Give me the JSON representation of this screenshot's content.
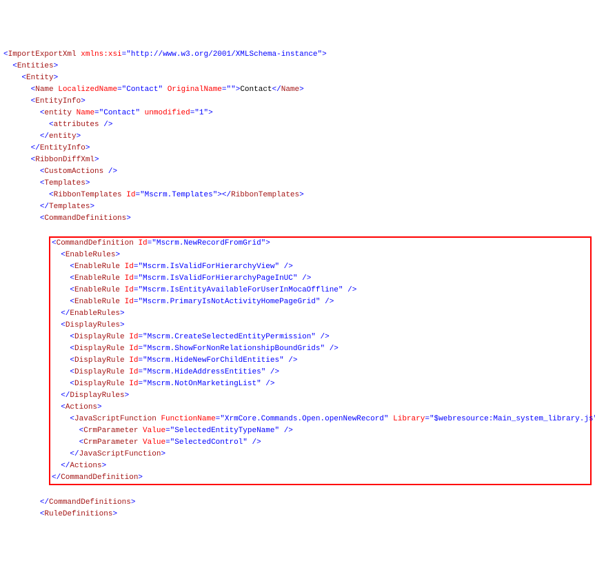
{
  "lines": [
    {
      "indent": 0,
      "parts": [
        {
          "c": "pun",
          "t": "<"
        },
        {
          "c": "tag",
          "t": "ImportExportXml"
        },
        {
          "c": "txt",
          "t": " "
        },
        {
          "c": "attr",
          "t": "xmlns:xsi"
        },
        {
          "c": "pun",
          "t": "=\""
        },
        {
          "c": "val",
          "t": "http://www.w3.org/2001/XMLSchema-instance"
        },
        {
          "c": "pun",
          "t": "\">"
        }
      ]
    },
    {
      "indent": 1,
      "parts": [
        {
          "c": "pun",
          "t": "<"
        },
        {
          "c": "tag",
          "t": "Entities"
        },
        {
          "c": "pun",
          "t": ">"
        }
      ]
    },
    {
      "indent": 2,
      "parts": [
        {
          "c": "pun",
          "t": "<"
        },
        {
          "c": "tag",
          "t": "Entity"
        },
        {
          "c": "pun",
          "t": ">"
        }
      ]
    },
    {
      "indent": 3,
      "parts": [
        {
          "c": "pun",
          "t": "<"
        },
        {
          "c": "tag",
          "t": "Name"
        },
        {
          "c": "txt",
          "t": " "
        },
        {
          "c": "attr",
          "t": "LocalizedName"
        },
        {
          "c": "pun",
          "t": "=\""
        },
        {
          "c": "val",
          "t": "Contact"
        },
        {
          "c": "pun",
          "t": "\" "
        },
        {
          "c": "attr",
          "t": "OriginalName"
        },
        {
          "c": "pun",
          "t": "=\""
        },
        {
          "c": "pun",
          "t": "\">"
        },
        {
          "c": "txt",
          "t": "Contact"
        },
        {
          "c": "pun",
          "t": "</"
        },
        {
          "c": "tag",
          "t": "Name"
        },
        {
          "c": "pun",
          "t": ">"
        }
      ]
    },
    {
      "indent": 3,
      "parts": [
        {
          "c": "pun",
          "t": "<"
        },
        {
          "c": "tag",
          "t": "EntityInfo"
        },
        {
          "c": "pun",
          "t": ">"
        }
      ]
    },
    {
      "indent": 4,
      "parts": [
        {
          "c": "pun",
          "t": "<"
        },
        {
          "c": "tag",
          "t": "entity"
        },
        {
          "c": "txt",
          "t": " "
        },
        {
          "c": "attr",
          "t": "Name"
        },
        {
          "c": "pun",
          "t": "=\""
        },
        {
          "c": "val",
          "t": "Contact"
        },
        {
          "c": "pun",
          "t": "\" "
        },
        {
          "c": "attr",
          "t": "unmodified"
        },
        {
          "c": "pun",
          "t": "=\""
        },
        {
          "c": "val",
          "t": "1"
        },
        {
          "c": "pun",
          "t": "\">"
        }
      ]
    },
    {
      "indent": 5,
      "parts": [
        {
          "c": "pun",
          "t": "<"
        },
        {
          "c": "tag",
          "t": "attributes"
        },
        {
          "c": "txt",
          "t": " "
        },
        {
          "c": "pun",
          "t": "/>"
        }
      ]
    },
    {
      "indent": 4,
      "parts": [
        {
          "c": "pun",
          "t": "</"
        },
        {
          "c": "tag",
          "t": "entity"
        },
        {
          "c": "pun",
          "t": ">"
        }
      ]
    },
    {
      "indent": 3,
      "parts": [
        {
          "c": "pun",
          "t": "</"
        },
        {
          "c": "tag",
          "t": "EntityInfo"
        },
        {
          "c": "pun",
          "t": ">"
        }
      ]
    },
    {
      "indent": 3,
      "parts": [
        {
          "c": "pun",
          "t": "<"
        },
        {
          "c": "tag",
          "t": "RibbonDiffXml"
        },
        {
          "c": "pun",
          "t": ">"
        }
      ]
    },
    {
      "indent": 4,
      "parts": [
        {
          "c": "pun",
          "t": "<"
        },
        {
          "c": "tag",
          "t": "CustomActions"
        },
        {
          "c": "txt",
          "t": " "
        },
        {
          "c": "pun",
          "t": "/>"
        }
      ]
    },
    {
      "indent": 4,
      "parts": [
        {
          "c": "pun",
          "t": "<"
        },
        {
          "c": "tag",
          "t": "Templates"
        },
        {
          "c": "pun",
          "t": ">"
        }
      ]
    },
    {
      "indent": 5,
      "parts": [
        {
          "c": "pun",
          "t": "<"
        },
        {
          "c": "tag",
          "t": "RibbonTemplates"
        },
        {
          "c": "txt",
          "t": " "
        },
        {
          "c": "attr",
          "t": "Id"
        },
        {
          "c": "pun",
          "t": "=\""
        },
        {
          "c": "val",
          "t": "Mscrm.Templates"
        },
        {
          "c": "pun",
          "t": "\"></"
        },
        {
          "c": "tag",
          "t": "RibbonTemplates"
        },
        {
          "c": "pun",
          "t": ">"
        }
      ]
    },
    {
      "indent": 4,
      "parts": [
        {
          "c": "pun",
          "t": "</"
        },
        {
          "c": "tag",
          "t": "Templates"
        },
        {
          "c": "pun",
          "t": ">"
        }
      ]
    },
    {
      "indent": 4,
      "parts": [
        {
          "c": "pun",
          "t": "<"
        },
        {
          "c": "tag",
          "t": "CommandDefinitions"
        },
        {
          "c": "pun",
          "t": ">"
        }
      ]
    }
  ],
  "highlighted": [
    {
      "indent": 5,
      "parts": [
        {
          "c": "pun",
          "t": "<"
        },
        {
          "c": "tag",
          "t": "CommandDefinition"
        },
        {
          "c": "txt",
          "t": " "
        },
        {
          "c": "attr",
          "t": "Id"
        },
        {
          "c": "pun",
          "t": "=\""
        },
        {
          "c": "val",
          "t": "Mscrm.NewRecordFromGrid"
        },
        {
          "c": "pun",
          "t": "\">"
        }
      ]
    },
    {
      "indent": 6,
      "parts": [
        {
          "c": "pun",
          "t": "<"
        },
        {
          "c": "tag",
          "t": "EnableRules"
        },
        {
          "c": "pun",
          "t": ">"
        }
      ]
    },
    {
      "indent": 7,
      "parts": [
        {
          "c": "pun",
          "t": "<"
        },
        {
          "c": "tag",
          "t": "EnableRule"
        },
        {
          "c": "txt",
          "t": " "
        },
        {
          "c": "attr",
          "t": "Id"
        },
        {
          "c": "pun",
          "t": "=\""
        },
        {
          "c": "val",
          "t": "Mscrm.IsValidForHierarchyView"
        },
        {
          "c": "pun",
          "t": "\" />"
        }
      ]
    },
    {
      "indent": 7,
      "parts": [
        {
          "c": "pun",
          "t": "<"
        },
        {
          "c": "tag",
          "t": "EnableRule"
        },
        {
          "c": "txt",
          "t": " "
        },
        {
          "c": "attr",
          "t": "Id"
        },
        {
          "c": "pun",
          "t": "=\""
        },
        {
          "c": "val",
          "t": "Mscrm.IsValidForHierarchyPageInUC"
        },
        {
          "c": "pun",
          "t": "\" />"
        }
      ]
    },
    {
      "indent": 7,
      "parts": [
        {
          "c": "pun",
          "t": "<"
        },
        {
          "c": "tag",
          "t": "EnableRule"
        },
        {
          "c": "txt",
          "t": " "
        },
        {
          "c": "attr",
          "t": "Id"
        },
        {
          "c": "pun",
          "t": "=\""
        },
        {
          "c": "val",
          "t": "Mscrm.IsEntityAvailableForUserInMocaOffline"
        },
        {
          "c": "pun",
          "t": "\" />"
        }
      ]
    },
    {
      "indent": 7,
      "parts": [
        {
          "c": "pun",
          "t": "<"
        },
        {
          "c": "tag",
          "t": "EnableRule"
        },
        {
          "c": "txt",
          "t": " "
        },
        {
          "c": "attr",
          "t": "Id"
        },
        {
          "c": "pun",
          "t": "=\""
        },
        {
          "c": "val",
          "t": "Mscrm.PrimaryIsNotActivityHomePageGrid"
        },
        {
          "c": "pun",
          "t": "\" />"
        }
      ]
    },
    {
      "indent": 6,
      "parts": [
        {
          "c": "pun",
          "t": "</"
        },
        {
          "c": "tag",
          "t": "EnableRules"
        },
        {
          "c": "pun",
          "t": ">"
        }
      ]
    },
    {
      "indent": 6,
      "parts": [
        {
          "c": "pun",
          "t": "<"
        },
        {
          "c": "tag",
          "t": "DisplayRules"
        },
        {
          "c": "pun",
          "t": ">"
        }
      ]
    },
    {
      "indent": 7,
      "parts": [
        {
          "c": "pun",
          "t": "<"
        },
        {
          "c": "tag",
          "t": "DisplayRule"
        },
        {
          "c": "txt",
          "t": " "
        },
        {
          "c": "attr",
          "t": "Id"
        },
        {
          "c": "pun",
          "t": "=\""
        },
        {
          "c": "val",
          "t": "Mscrm.CreateSelectedEntityPermission"
        },
        {
          "c": "pun",
          "t": "\" />"
        }
      ]
    },
    {
      "indent": 7,
      "parts": [
        {
          "c": "pun",
          "t": "<"
        },
        {
          "c": "tag",
          "t": "DisplayRule"
        },
        {
          "c": "txt",
          "t": " "
        },
        {
          "c": "attr",
          "t": "Id"
        },
        {
          "c": "pun",
          "t": "=\""
        },
        {
          "c": "val",
          "t": "Mscrm.ShowForNonRelationshipBoundGrids"
        },
        {
          "c": "pun",
          "t": "\" />"
        }
      ]
    },
    {
      "indent": 7,
      "parts": [
        {
          "c": "pun",
          "t": "<"
        },
        {
          "c": "tag",
          "t": "DisplayRule"
        },
        {
          "c": "txt",
          "t": " "
        },
        {
          "c": "attr",
          "t": "Id"
        },
        {
          "c": "pun",
          "t": "=\""
        },
        {
          "c": "val",
          "t": "Mscrm.HideNewForChildEntities"
        },
        {
          "c": "pun",
          "t": "\" />"
        }
      ]
    },
    {
      "indent": 7,
      "parts": [
        {
          "c": "pun",
          "t": "<"
        },
        {
          "c": "tag",
          "t": "DisplayRule"
        },
        {
          "c": "txt",
          "t": " "
        },
        {
          "c": "attr",
          "t": "Id"
        },
        {
          "c": "pun",
          "t": "=\""
        },
        {
          "c": "val",
          "t": "Mscrm.HideAddressEntities"
        },
        {
          "c": "pun",
          "t": "\" />"
        }
      ]
    },
    {
      "indent": 7,
      "parts": [
        {
          "c": "pun",
          "t": "<"
        },
        {
          "c": "tag",
          "t": "DisplayRule"
        },
        {
          "c": "txt",
          "t": " "
        },
        {
          "c": "attr",
          "t": "Id"
        },
        {
          "c": "pun",
          "t": "=\""
        },
        {
          "c": "val",
          "t": "Mscrm.NotOnMarketingList"
        },
        {
          "c": "pun",
          "t": "\" />"
        }
      ]
    },
    {
      "indent": 6,
      "parts": [
        {
          "c": "pun",
          "t": "</"
        },
        {
          "c": "tag",
          "t": "DisplayRules"
        },
        {
          "c": "pun",
          "t": ">"
        }
      ]
    },
    {
      "indent": 6,
      "parts": [
        {
          "c": "pun",
          "t": "<"
        },
        {
          "c": "tag",
          "t": "Actions"
        },
        {
          "c": "pun",
          "t": ">"
        }
      ]
    },
    {
      "indent": 7,
      "parts": [
        {
          "c": "pun",
          "t": "<"
        },
        {
          "c": "tag",
          "t": "JavaScriptFunction"
        },
        {
          "c": "txt",
          "t": " "
        },
        {
          "c": "attr",
          "t": "FunctionName"
        },
        {
          "c": "pun",
          "t": "=\""
        },
        {
          "c": "val",
          "t": "XrmCore.Commands.Open.openNewRecord"
        },
        {
          "c": "pun",
          "t": "\" "
        },
        {
          "c": "attr",
          "t": "Library"
        },
        {
          "c": "pun",
          "t": "=\""
        },
        {
          "c": "val",
          "t": "$webresource:Main_system_library.js"
        },
        {
          "c": "pun",
          "t": "\">"
        }
      ]
    },
    {
      "indent": 8,
      "parts": [
        {
          "c": "pun",
          "t": "<"
        },
        {
          "c": "tag",
          "t": "CrmParameter"
        },
        {
          "c": "txt",
          "t": " "
        },
        {
          "c": "attr",
          "t": "Value"
        },
        {
          "c": "pun",
          "t": "=\""
        },
        {
          "c": "val",
          "t": "SelectedEntityTypeName"
        },
        {
          "c": "pun",
          "t": "\" />"
        }
      ]
    },
    {
      "indent": 8,
      "parts": [
        {
          "c": "pun",
          "t": "<"
        },
        {
          "c": "tag",
          "t": "CrmParameter"
        },
        {
          "c": "txt",
          "t": " "
        },
        {
          "c": "attr",
          "t": "Value"
        },
        {
          "c": "pun",
          "t": "=\""
        },
        {
          "c": "val",
          "t": "SelectedControl"
        },
        {
          "c": "pun",
          "t": "\" />"
        }
      ]
    },
    {
      "indent": 7,
      "parts": [
        {
          "c": "pun",
          "t": "</"
        },
        {
          "c": "tag",
          "t": "JavaScriptFunction"
        },
        {
          "c": "pun",
          "t": ">"
        }
      ]
    },
    {
      "indent": 6,
      "parts": [
        {
          "c": "pun",
          "t": "</"
        },
        {
          "c": "tag",
          "t": "Actions"
        },
        {
          "c": "pun",
          "t": ">"
        }
      ]
    },
    {
      "indent": 5,
      "parts": [
        {
          "c": "pun",
          "t": "</"
        },
        {
          "c": "tag",
          "t": "CommandDefinition"
        },
        {
          "c": "pun",
          "t": ">"
        }
      ]
    }
  ],
  "after": [
    {
      "indent": 4,
      "parts": [
        {
          "c": "pun",
          "t": "</"
        },
        {
          "c": "tag",
          "t": "CommandDefinitions"
        },
        {
          "c": "pun",
          "t": ">"
        }
      ]
    },
    {
      "indent": 4,
      "parts": [
        {
          "c": "pun",
          "t": "<"
        },
        {
          "c": "tag",
          "t": "RuleDefinitions"
        },
        {
          "c": "pun",
          "t": ">"
        }
      ]
    }
  ],
  "indentUnit": "  "
}
